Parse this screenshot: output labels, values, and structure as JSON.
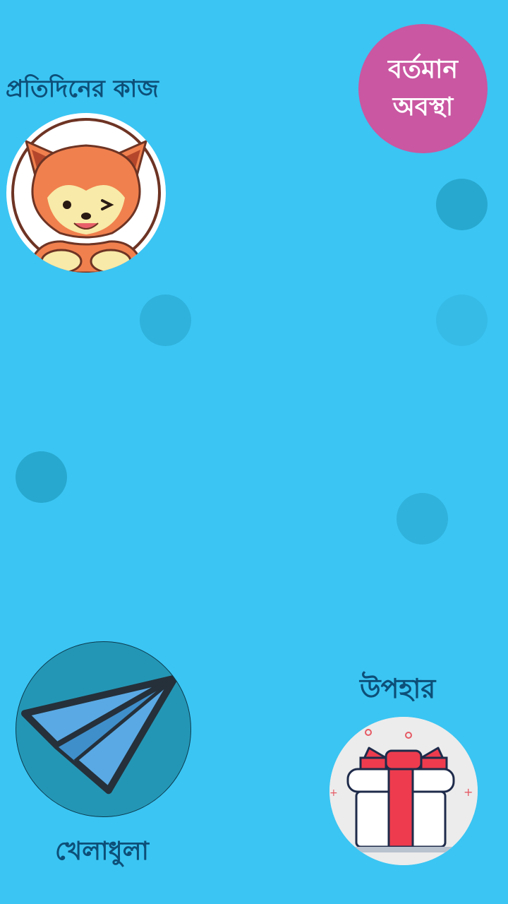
{
  "screen": {
    "background_color": "#3bc5f3",
    "accent_text_color": "#0d4f78",
    "status_button_color": "#c957a1"
  },
  "daily_tasks": {
    "label": "প্রতিদিনের কাজ",
    "icon": "fox-mascot-icon"
  },
  "current_status": {
    "line1": "বর্তমান",
    "line2": "অবস্থা"
  },
  "gift": {
    "label": "উপহার",
    "icon": "gift-box-icon"
  },
  "play": {
    "label": "খেলাধুলা",
    "icon": "paper-plane-icon"
  }
}
